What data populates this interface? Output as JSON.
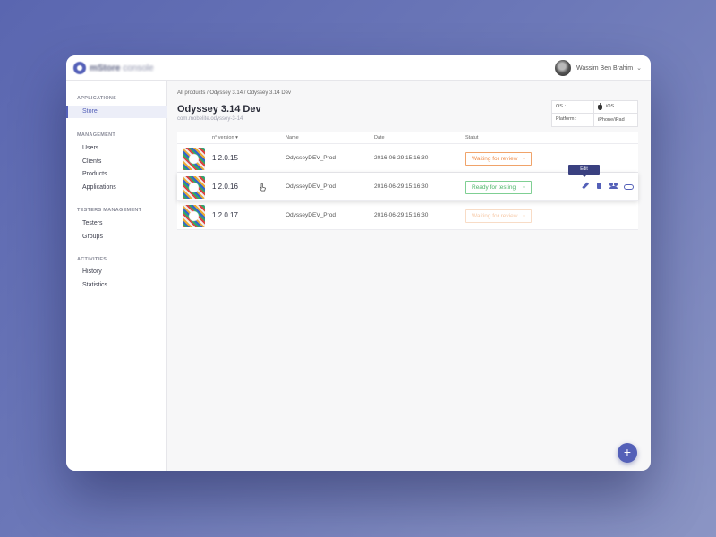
{
  "app": {
    "logo_bold": "mStore",
    "logo_light": "console"
  },
  "user": {
    "name": "Wassim Ben Brahim",
    "caret": "⌄"
  },
  "sidebar": {
    "sections": [
      {
        "title": "APPLICATIONS",
        "items": [
          {
            "label": "Store",
            "active": true
          }
        ]
      },
      {
        "title": "MANAGEMENT",
        "items": [
          {
            "label": "Users"
          },
          {
            "label": "Clients"
          },
          {
            "label": "Products"
          },
          {
            "label": "Applications"
          }
        ]
      },
      {
        "title": "TESTERS MANAGEMENT",
        "items": [
          {
            "label": "Testers"
          },
          {
            "label": "Groups"
          }
        ]
      },
      {
        "title": "ACTIVITIES",
        "items": [
          {
            "label": "History"
          },
          {
            "label": "Statistics"
          }
        ]
      }
    ]
  },
  "breadcrumb": "All products / Odyssey 3.14 / Odyssey 3.14 Dev",
  "page": {
    "title": "Odyssey 3.14 Dev",
    "bundle_id": "com.mobelite.odyssey-3-14"
  },
  "info": {
    "os_label": "OS :",
    "os_value": "iOS",
    "platform_label": "Platform :",
    "platform_value": "iPhone/iPad"
  },
  "table": {
    "headers": {
      "version": "n° version",
      "sort_arrow": "▾",
      "name": "Name",
      "date": "Date",
      "status": "Statut"
    },
    "rows": [
      {
        "version": "1.2.0.15",
        "name": "OdysseyDEV_Prod",
        "date": "2016-06-29 15:16:30",
        "status": "Waiting for review",
        "status_color": "#ef8f4e"
      },
      {
        "version": "1.2.0.16",
        "name": "OdysseyDEV_Prod",
        "date": "2016-06-29 15:16:30",
        "status": "Ready for testing",
        "status_color": "#4bb568"
      },
      {
        "version": "1.2.0.17",
        "name": "OdysseyDEV_Prod",
        "date": "2016-06-29 15:16:30",
        "status": "Waiting for review",
        "status_color": "#f6c9a7"
      }
    ],
    "tooltip": "Edit"
  },
  "fab": {
    "label": "+"
  },
  "colors": {
    "accent": "#5460b8",
    "tooltip_bg": "#3a4080"
  }
}
